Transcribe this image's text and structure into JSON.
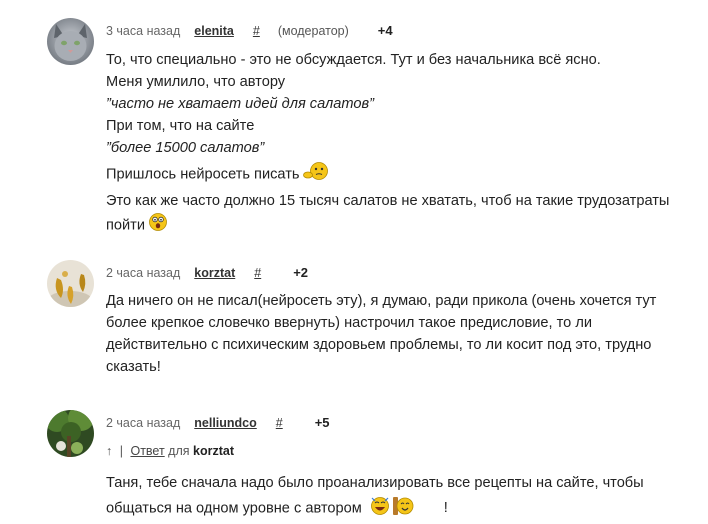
{
  "comments": [
    {
      "time": "3 часа назад",
      "author": "elenita",
      "hash": "#",
      "role": "(модератор)",
      "score": "+4",
      "lines": [
        "То, что специально - это не обсуждается. Тут и без начальника всё ясно.",
        "Меня умилило, что автору",
        "”часто не хватает идей для салатов”",
        "При том, что на сайте",
        "”более 15000 салатов”",
        "Пришлось нейросеть писать",
        "Это как же часто должно 15 тысяч салатов не хватать, чтоб на такие трудозатраты",
        "пойти"
      ]
    },
    {
      "time": "2 часа назад",
      "author": "korztat",
      "hash": "#",
      "score": "+2",
      "lines": [
        "Да ничего он не писал(нейросеть эту), я думаю, ради прикола (очень хочется тут",
        "более крепкое словечко ввернуть) настрочил такое предисловие, то ли",
        "действительно с психическим здоровьем проблемы, то ли косит под это, трудно",
        "сказать!"
      ]
    },
    {
      "time": "2 часа назад",
      "author": "nelliundco",
      "hash": "#",
      "score": "+5",
      "reply_arrow": "↑",
      "reply_sep": "|",
      "reply_label": "Ответ",
      "reply_for": "для",
      "reply_to": "korztat",
      "lines": [
        "Таня, тебе сначала надо было проанализировать все рецепты на сайте, чтобы",
        "общаться на одном уровне с автором",
        "!"
      ]
    }
  ],
  "icons": {
    "c1_avatar": "cat-avatar",
    "c2_avatar": "gold-ornament-avatar",
    "c3_avatar": "forest-avatar",
    "smiley_thinking": "thinking-smiley-icon",
    "smiley_shocked": "shocked-smiley-icon",
    "smiley_laughing": "laughing-smiley-icon",
    "smiley_clapping": "clapping-smiley-icon"
  },
  "colors": {
    "text": "#222222",
    "meta": "#555555",
    "smiley": "#f5c518"
  }
}
